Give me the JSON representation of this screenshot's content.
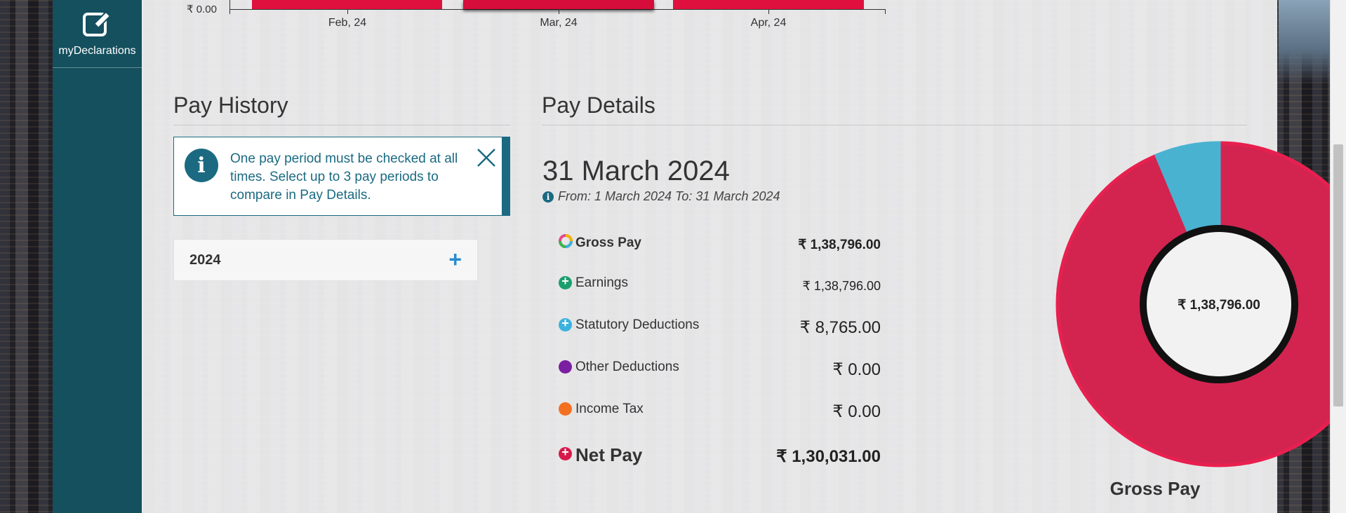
{
  "sidebar": {
    "items": [
      {
        "label": "myDeclarations",
        "icon": "edit-icon"
      }
    ]
  },
  "top_chart": {
    "y_tick": "₹ 0.00",
    "x_labels": [
      "Feb, 24",
      "Mar, 24",
      "Apr, 24"
    ],
    "selected": "Mar, 24",
    "bar_color": "#e0103e"
  },
  "pay_history": {
    "title": "Pay History",
    "alert_message": "One pay period must be checked at all times. Select up to 3 pay periods to compare in Pay Details.",
    "years": [
      {
        "label": "2024",
        "expand": "+"
      }
    ]
  },
  "pay_details": {
    "title": "Pay Details",
    "date": "31 March 2024",
    "range": "From: 1 March 2024 To: 31 March 2024",
    "rows": [
      {
        "label": "Gross Pay",
        "value": "₹ 1,38,796.00",
        "icon": "gross-pay-ring-icon"
      },
      {
        "label": "Earnings",
        "value": "₹ 1,38,796.00",
        "icon": "plus-green-icon",
        "color": "#1a9e6e"
      },
      {
        "label": "Statutory Deductions",
        "value": "₹ 8,765.00",
        "icon": "plus-blue-icon",
        "color": "#3bb3de"
      },
      {
        "label": "Other Deductions",
        "value": "₹ 0.00",
        "icon": "purple-dot-icon",
        "color": "#7b1fa2"
      },
      {
        "label": "Income Tax",
        "value": "₹ 0.00",
        "icon": "orange-dot-icon",
        "color": "#f37021"
      },
      {
        "label": "Net Pay",
        "value": "₹ 1,30,031.00",
        "icon": "plus-red-icon",
        "color": "#d7194a"
      }
    ]
  },
  "chart_data": {
    "type": "pie",
    "title": "Gross Pay",
    "center_label": "₹ 1,38,796.00",
    "slices": [
      {
        "name": "Earnings",
        "value": 130031,
        "color": "#d32450"
      },
      {
        "name": "Statutory Deductions",
        "value": 8765,
        "color": "#4ab2d1"
      }
    ]
  }
}
